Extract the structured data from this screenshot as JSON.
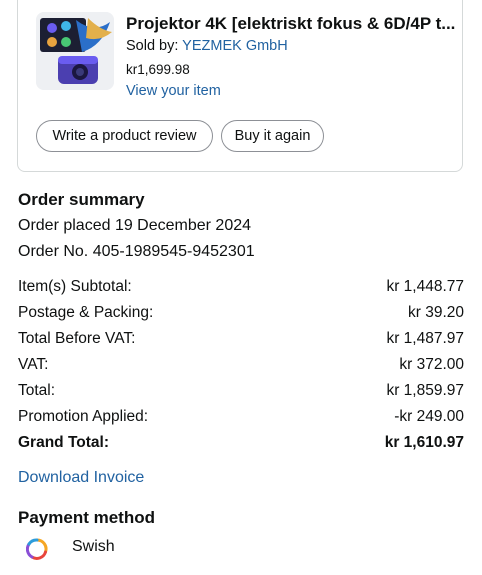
{
  "item": {
    "title": "Projektor 4K [elektriskt fokus & 6D/4P t...",
    "sold_by_label": "Sold by: ",
    "seller": "YEZMEK GmbH",
    "price": "kr1,699.98",
    "view_link": "View your item",
    "review_button": "Write a product review",
    "buy_again_button": "Buy it again"
  },
  "order_summary": {
    "heading": "Order summary",
    "placed": "Order placed 19 December 2024",
    "number": "Order No. 405-1989545-9452301",
    "rows": [
      {
        "label": "Item(s) Subtotal:",
        "value": "kr 1,448.77"
      },
      {
        "label": "Postage & Packing:",
        "value": "kr 39.20"
      },
      {
        "label": "Total Before VAT:",
        "value": "kr 1,487.97"
      },
      {
        "label": "VAT:",
        "value": "kr 372.00"
      },
      {
        "label": "Total:",
        "value": "kr 1,859.97"
      },
      {
        "label": "Promotion Applied:",
        "value": "-kr 249.00"
      },
      {
        "label": "Grand Total:",
        "value": "kr 1,610.97"
      }
    ],
    "download_invoice": "Download Invoice"
  },
  "payment": {
    "heading": "Payment method",
    "method": "Swish",
    "icon": "swish-icon"
  }
}
